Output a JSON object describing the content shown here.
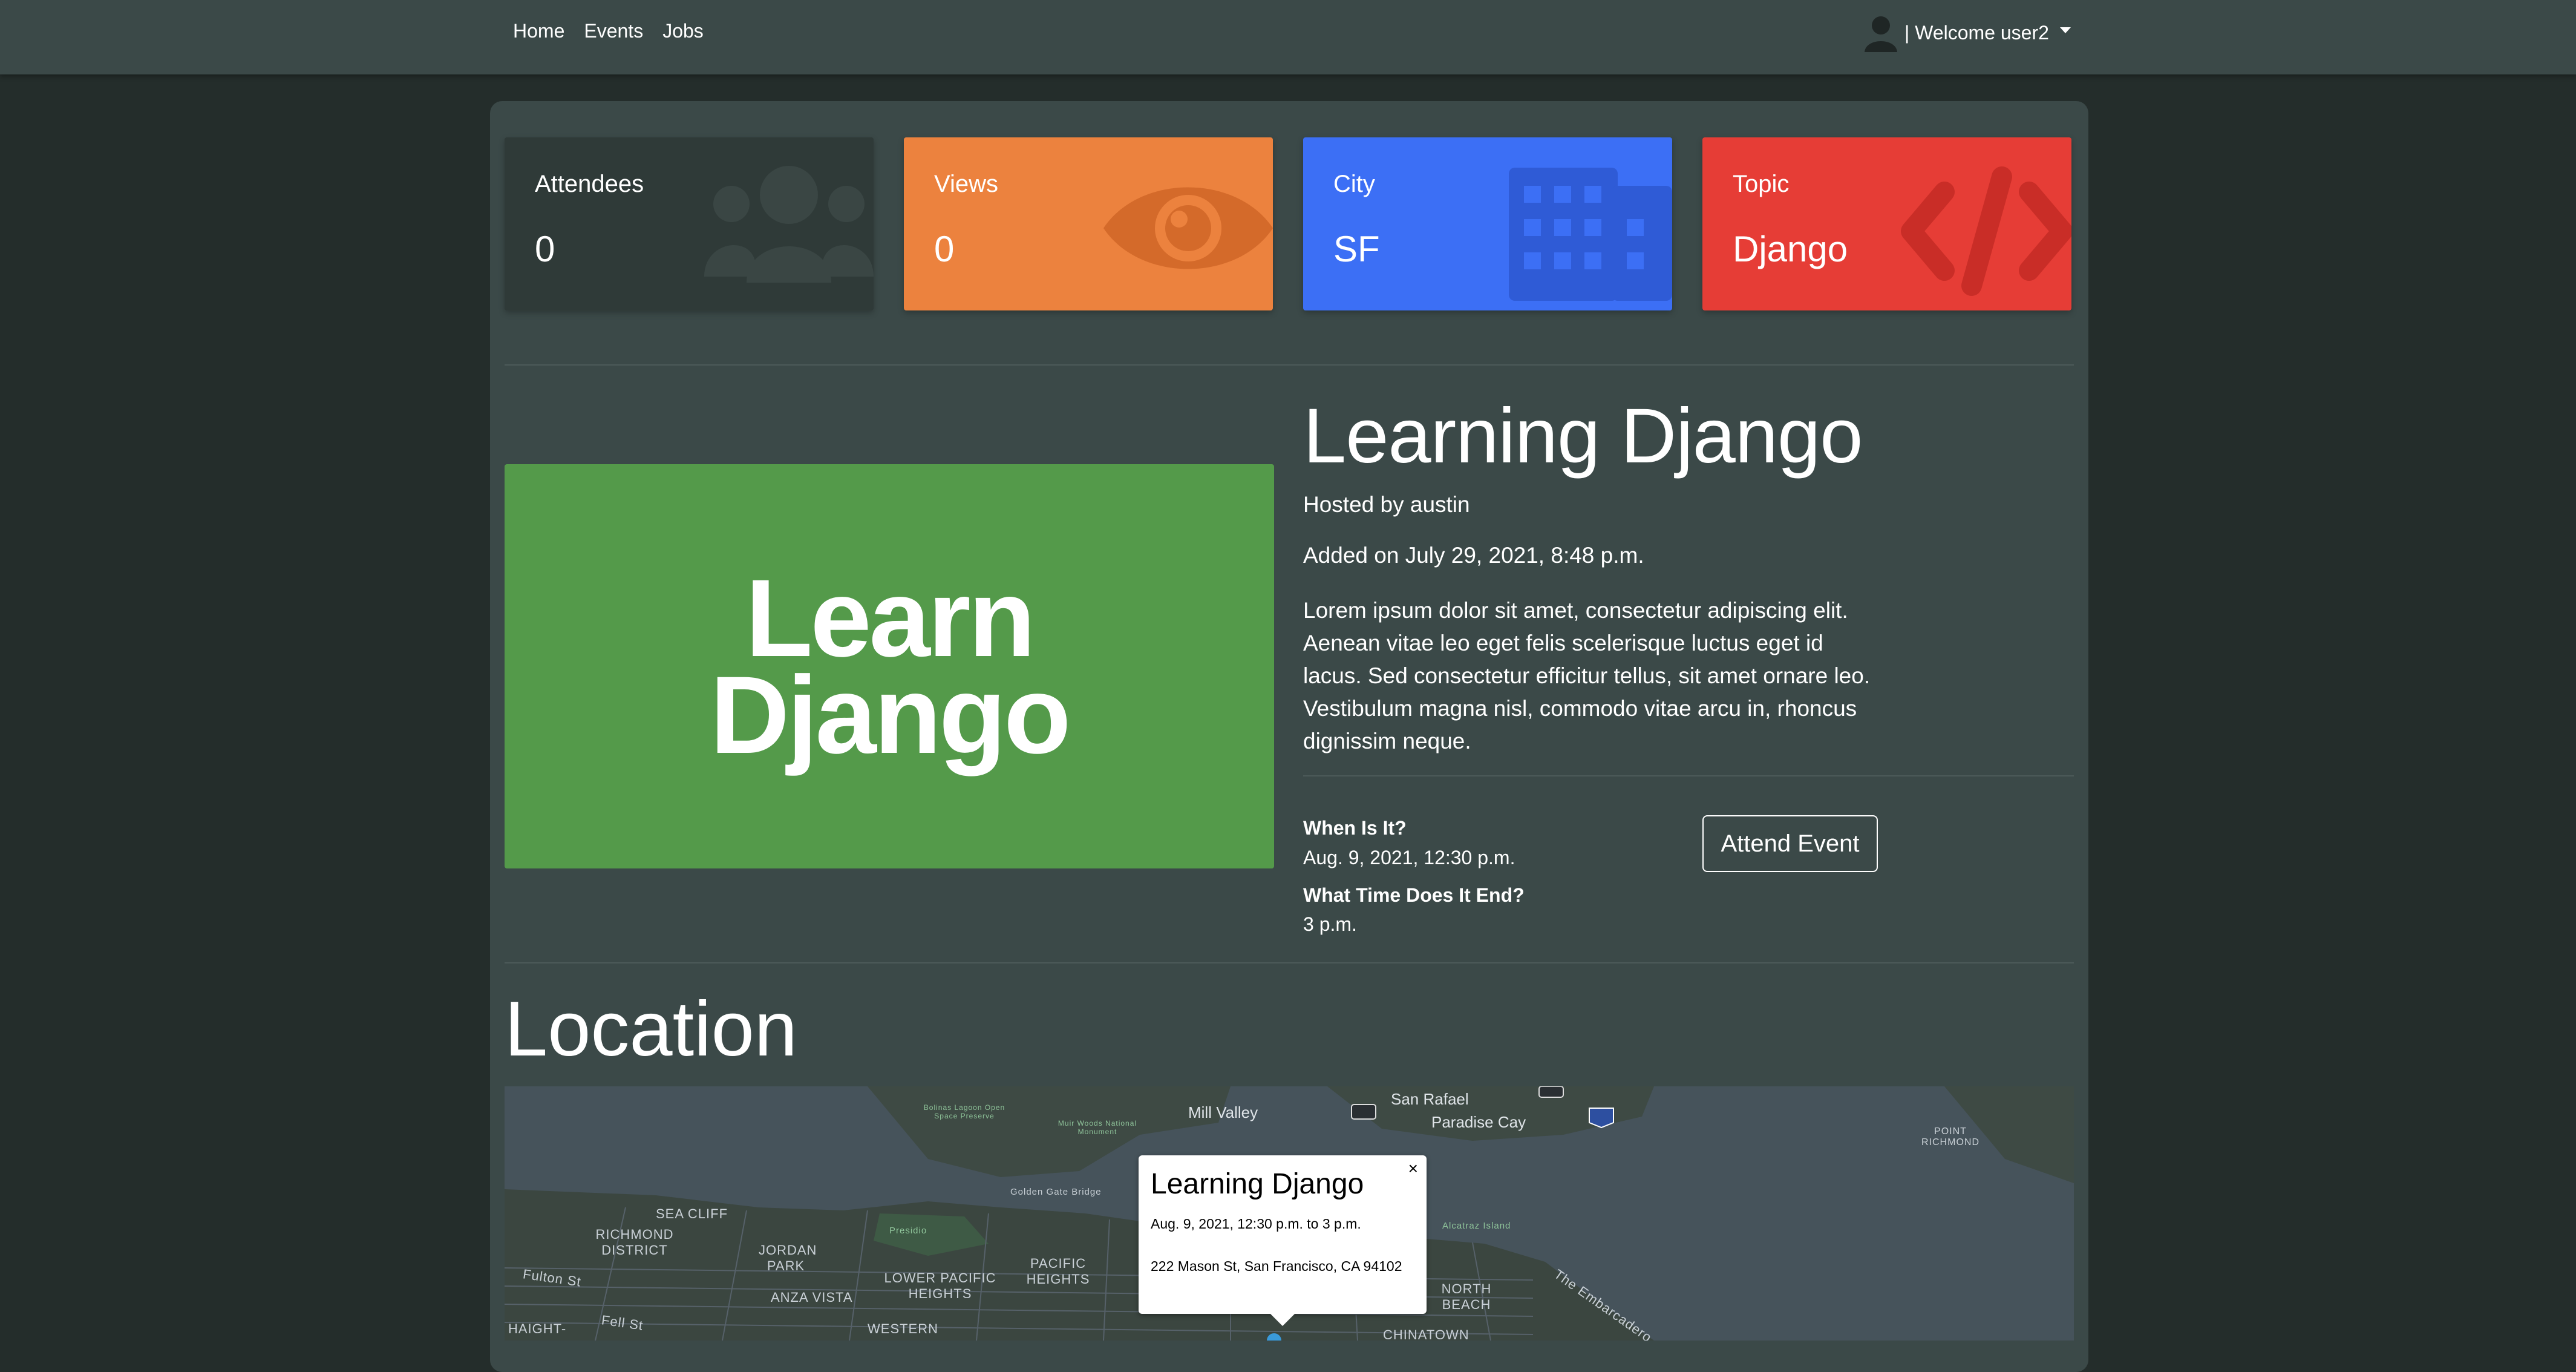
{
  "nav": {
    "links": [
      "Home",
      "Events",
      "Jobs"
    ],
    "user_label": "| Welcome user2"
  },
  "stats": [
    {
      "label": "Attendees",
      "value": "0",
      "color": "#2f3a38",
      "icon": "users-icon"
    },
    {
      "label": "Views",
      "value": "0",
      "color": "#ec823e",
      "icon": "eye-icon"
    },
    {
      "label": "City",
      "value": "SF",
      "color": "#3c6ff5",
      "icon": "building-icon"
    },
    {
      "label": "Topic",
      "value": "Django",
      "color": "#e63d36",
      "icon": "code-icon"
    }
  ],
  "event": {
    "image_text_line1": "Learn",
    "image_text_line2": "Django",
    "image_color": "#549a4a",
    "title": "Learning Django",
    "host": "Hosted by austin",
    "added": "Added on July 29, 2021, 8:48 p.m.",
    "description": "Lorem ipsum dolor sit amet, consectetur adipiscing elit. Aenean vitae leo eget felis scelerisque luctus eget id lacus. Sed consectetur efficitur tellus, sit amet ornare leo. Vestibulum magna nisl, commodo vitae arcu in, rhoncus dignissim neque.",
    "when_label": "When Is It?",
    "when_value": "Aug. 9, 2021, 12:30 p.m.",
    "end_label": "What Time Does It End?",
    "end_value": "3 p.m.",
    "attend_button": "Attend Event"
  },
  "location": {
    "heading": "Location",
    "map_labels": {
      "mill_valley": "Mill Valley",
      "san_rafael": "San Rafael",
      "paradise_cay": "Paradise Cay",
      "point_richmond": "POINT RICHMOND",
      "sea_cliff": "SEA CLIFF",
      "richmond_district": "RICHMOND DISTRICT",
      "jordan_park": "JORDAN PARK",
      "lower_pacific_heights": "LOWER PACIFIC HEIGHTS",
      "pacific_heights": "PACIFIC HEIGHTS",
      "anza_vista": "ANZA VISTA",
      "western": "WESTERN",
      "north_beach": "NORTH BEACH",
      "chinatown": "CHINATOWN",
      "haight": "HAIGHT-",
      "presidio": "Presidio",
      "golden_gate_bridge": "Golden Gate Bridge",
      "alcatraz": "Alcatraz Island",
      "muir_woods": "Muir Woods National Monument",
      "bolinas_lagoon": "Bolinas Lagoon Open Space Preserve",
      "fulton_st": "Fulton St",
      "fell_st": "Fell St",
      "the_embarcadero": "The Embarcadero"
    },
    "popup": {
      "title": "Learning Django",
      "time": "Aug. 9, 2021, 12:30 p.m. to 3 p.m.",
      "address": "222 Mason St, San Francisco, CA 94102",
      "close": "×"
    }
  }
}
